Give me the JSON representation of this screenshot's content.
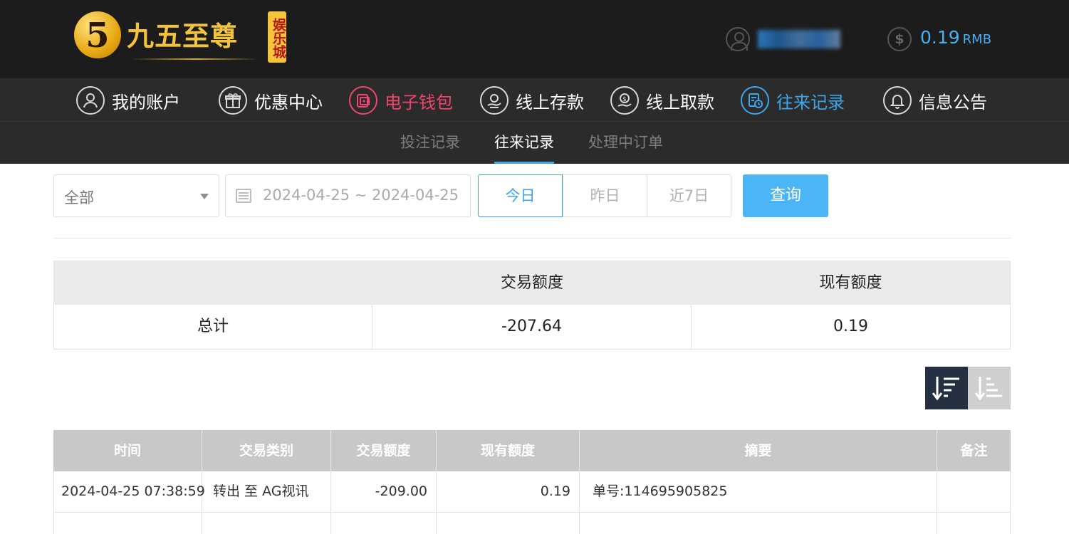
{
  "brand": {
    "logo_numeral": "5",
    "name": "九五至尊",
    "badge": "娱乐城"
  },
  "account": {
    "username": "lushu5",
    "balance": "0.19",
    "currency": "RMB",
    "icons": {
      "user": "user-icon",
      "balance": "dollar-coin-icon"
    }
  },
  "main_nav": [
    {
      "label": "我的账户",
      "icon": "user-circle-icon",
      "glyph": "👤",
      "state": "normal"
    },
    {
      "label": "优惠中心",
      "icon": "gift-icon",
      "glyph": "🎁",
      "state": "normal"
    },
    {
      "label": "电子钱包",
      "icon": "wallet-icon",
      "glyph": "▣",
      "state": "active-red"
    },
    {
      "label": "线上存款",
      "icon": "deposit-hand-icon",
      "glyph": "✋",
      "state": "normal"
    },
    {
      "label": "线上取款",
      "icon": "withdraw-coin-icon",
      "glyph": "$",
      "state": "normal"
    },
    {
      "label": "往来记录",
      "icon": "record-clock-icon",
      "glyph": "◷",
      "state": "active-blue"
    },
    {
      "label": "信息公告",
      "icon": "bell-icon",
      "glyph": "🔔",
      "state": "normal"
    }
  ],
  "sub_nav": [
    {
      "label": "投注记录",
      "active": false
    },
    {
      "label": "往来记录",
      "active": true
    },
    {
      "label": "处理中订单",
      "active": false
    }
  ],
  "filters": {
    "type_select": "全部",
    "date_range": "2024-04-25 ~ 2024-04-25",
    "quick_ranges": [
      "今日",
      "昨日",
      "近7日"
    ],
    "active_quick": "今日",
    "query_button": "查询"
  },
  "summary": {
    "headers": [
      "",
      "交易额度",
      "现有额度"
    ],
    "row": {
      "label": "总计",
      "transaction": "-207.64",
      "balance": "0.19"
    }
  },
  "sort": {
    "desc_icon": "sort-desc-icon",
    "asc_icon": "sort-asc-icon",
    "active": "desc"
  },
  "records": {
    "headers": [
      "时间",
      "交易类别",
      "交易额度",
      "现有额度",
      "摘要",
      "备注"
    ],
    "rows": [
      {
        "time": "2024-04-25 07:38:59",
        "type": "转出 至 AG视讯",
        "amount": "-209.00",
        "balance": "0.19",
        "summary": "单号:114695905825",
        "note": ""
      }
    ]
  },
  "colors": {
    "header_bg": "#1c1c1c",
    "nav_bg": "#2b2b2b",
    "accent_blue": "#3da6ea",
    "accent_red": "#f0456d",
    "query_btn": "#4cb5f5",
    "table_head": "#c8c8c8"
  }
}
